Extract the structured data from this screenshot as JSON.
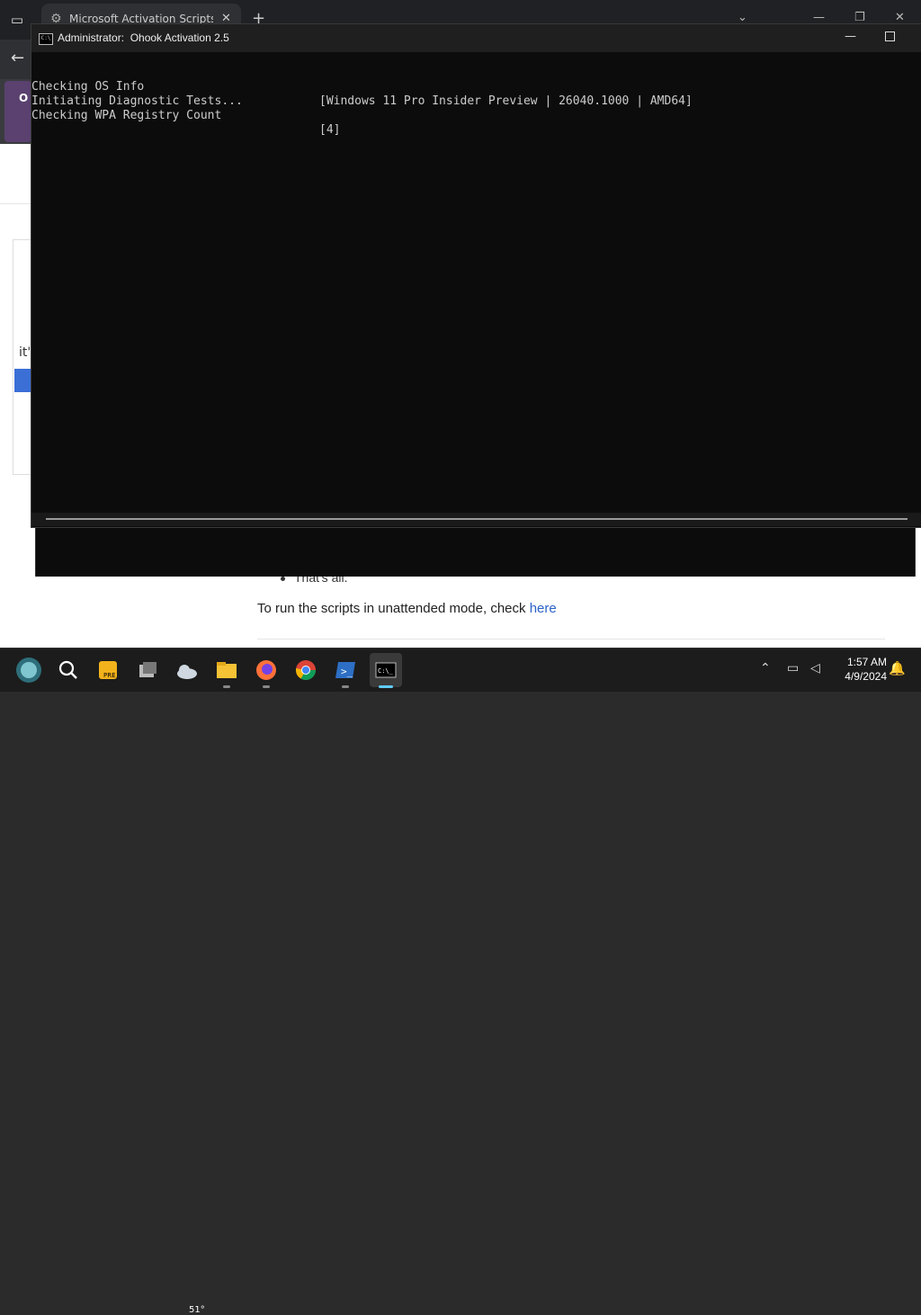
{
  "browser": {
    "tab_title": "Microsoft Activation Scripts (M",
    "new_tab_symbol": "+",
    "side_label": "O",
    "page": {
      "snippet": "it'",
      "bullet_text": "That's all.",
      "unattended_prefix": "To run the scripts in unattended mode, check ",
      "unattended_link": "here"
    }
  },
  "console": {
    "title": "Administrator:  Ohook Activation 2.5",
    "icon_text": "C:\\",
    "lines": [
      {
        "label": "Checking OS Info",
        "value": "[Windows 11 Pro Insider Preview | 26040.1000 | AMD64]"
      },
      {
        "label": "Initiating Diagnostic Tests...",
        "value": ""
      },
      {
        "label": "Checking WPA Registry Count",
        "value": "[4]"
      }
    ]
  },
  "taskbar": {
    "weather_temp": "51°",
    "clock_time": "1:57 AM",
    "clock_date": "4/9/2024",
    "icons": [
      "start-icon",
      "search-icon",
      "pre-app-icon",
      "task-view-icon",
      "weather-icon",
      "file-explorer-icon",
      "firefox-icon",
      "chrome-icon",
      "powershell-icon",
      "terminal-icon"
    ]
  }
}
